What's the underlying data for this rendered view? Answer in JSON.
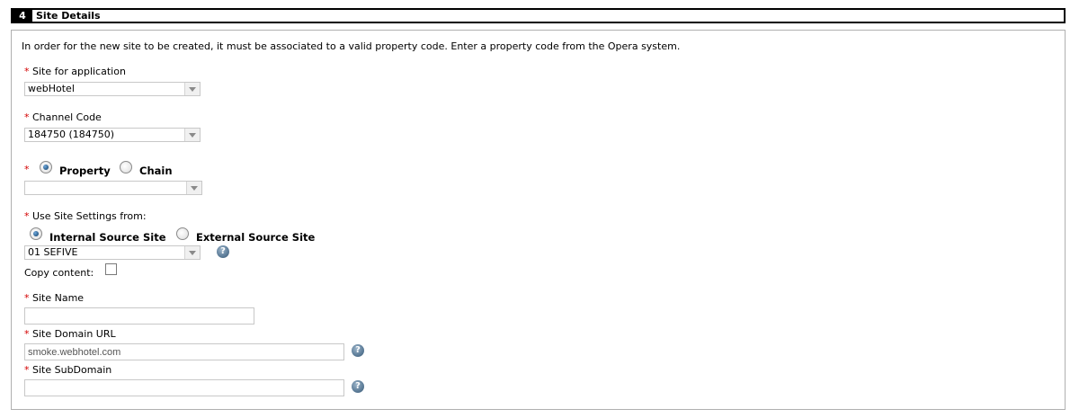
{
  "section": {
    "number": "4",
    "title": "Site Details"
  },
  "intro": "In order for the new site to be created, it must be associated to a valid property code. Enter a property code from the Opera system.",
  "required_mark": "*",
  "site_for_application": {
    "label": "Site for application",
    "value": "webHotel"
  },
  "channel_code": {
    "label": "Channel Code",
    "value": "184750 (184750)"
  },
  "property_chain": {
    "option_property": "Property",
    "option_chain": "Chain",
    "selected": "Property",
    "value": ""
  },
  "use_site_settings": {
    "label": "Use Site Settings from:",
    "option_internal": "Internal Source Site",
    "option_external": "External Source Site",
    "selected": "Internal Source Site",
    "value": "01 SEFIVE"
  },
  "copy_content": {
    "label": "Copy content:",
    "checked": false
  },
  "site_name": {
    "label": "Site Name",
    "value": ""
  },
  "site_domain_url": {
    "label": "Site Domain URL",
    "value": "smoke.webhotel.com"
  },
  "site_subdomain": {
    "label": "Site SubDomain",
    "value": ""
  },
  "help_glyph": "?",
  "colors": {
    "required": "#d40000",
    "header_bg": "#000000",
    "border": "#b0b0b0"
  }
}
